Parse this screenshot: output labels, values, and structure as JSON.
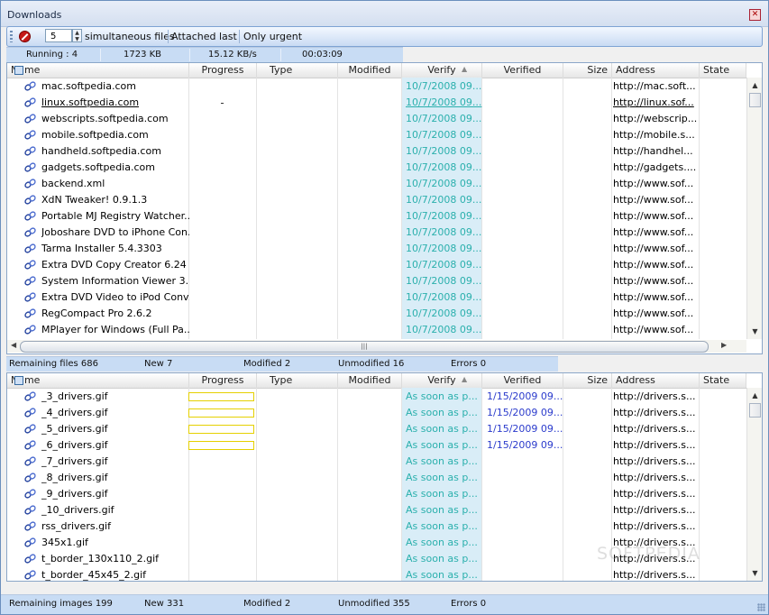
{
  "window": {
    "title": "Downloads",
    "close_icon": "close-icon"
  },
  "toolbar": {
    "simultaneous_value": "5",
    "simultaneous_label": "simultaneous files",
    "attached_last_label": "Attached last",
    "only_urgent_label": "Only urgent"
  },
  "status_top": {
    "running": "Running : 4",
    "size": "1723 KB",
    "speed": "15.12 KB/s",
    "time": "00:03:09"
  },
  "columns": [
    "Name",
    "Progress",
    "Type",
    "Modified",
    "Verify",
    "Verified",
    "Size",
    "Address",
    "State"
  ],
  "top_rows": [
    {
      "name": "mac.softpedia.com",
      "verify": "10/7/2008 09...",
      "address": "http://mac.soft...",
      "underline": false,
      "progress": false
    },
    {
      "name": "linux.softpedia.com",
      "verify": "10/7/2008 09...",
      "address": "http://linux.sof...",
      "underline": true,
      "progress": true
    },
    {
      "name": "webscripts.softpedia.com",
      "verify": "10/7/2008 09...",
      "address": "http://webscrip...",
      "underline": false,
      "progress": false
    },
    {
      "name": "mobile.softpedia.com",
      "verify": "10/7/2008 09...",
      "address": "http://mobile.s...",
      "underline": false,
      "progress": false
    },
    {
      "name": "handheld.softpedia.com",
      "verify": "10/7/2008 09...",
      "address": "http://handhel...",
      "underline": false,
      "progress": false
    },
    {
      "name": "gadgets.softpedia.com",
      "verify": "10/7/2008 09...",
      "address": "http://gadgets....",
      "underline": false,
      "progress": false
    },
    {
      "name": "backend.xml",
      "verify": "10/7/2008 09...",
      "address": "http://www.sof...",
      "underline": false,
      "progress": false
    },
    {
      "name": "XdN Tweaker! 0.9.1.3",
      "verify": "10/7/2008 09...",
      "address": "http://www.sof...",
      "underline": false,
      "progress": false
    },
    {
      "name": "Portable MJ Registry Watcher...",
      "verify": "10/7/2008 09...",
      "address": "http://www.sof...",
      "underline": false,
      "progress": false
    },
    {
      "name": "Joboshare DVD to iPhone Con...",
      "verify": "10/7/2008 09...",
      "address": "http://www.sof...",
      "underline": false,
      "progress": false
    },
    {
      "name": "Tarma Installer 5.4.3303",
      "verify": "10/7/2008 09...",
      "address": "http://www.sof...",
      "underline": false,
      "progress": false
    },
    {
      "name": "Extra DVD Copy Creator 6.24",
      "verify": "10/7/2008 09...",
      "address": "http://www.sof...",
      "underline": false,
      "progress": false
    },
    {
      "name": "System Information Viewer 3....",
      "verify": "10/7/2008 09...",
      "address": "http://www.sof...",
      "underline": false,
      "progress": false
    },
    {
      "name": "Extra DVD Video to iPod Conv...",
      "verify": "10/7/2008 09...",
      "address": "http://www.sof...",
      "underline": false,
      "progress": false
    },
    {
      "name": "RegCompact Pro 2.6.2",
      "verify": "10/7/2008 09...",
      "address": "http://www.sof...",
      "underline": false,
      "progress": false
    },
    {
      "name": "MPlayer for Windows (Full Pa...",
      "verify": "10/7/2008 09...",
      "address": "http://www.sof...",
      "underline": false,
      "progress": false
    }
  ],
  "status_mid": {
    "remaining": "Remaining files 686",
    "new": "New 7",
    "modified": "Modified 2",
    "unmodified": "Unmodified 16",
    "errors": "Errors 0"
  },
  "bottom_rows": [
    {
      "name": "_3_drivers.gif",
      "verify": "As soon as p...",
      "verified": "1/15/2009 09...",
      "address": "http://drivers.s...",
      "progress": true
    },
    {
      "name": "_4_drivers.gif",
      "verify": "As soon as p...",
      "verified": "1/15/2009 09...",
      "address": "http://drivers.s...",
      "progress": true
    },
    {
      "name": "_5_drivers.gif",
      "verify": "As soon as p...",
      "verified": "1/15/2009 09...",
      "address": "http://drivers.s...",
      "progress": true
    },
    {
      "name": "_6_drivers.gif",
      "verify": "As soon as p...",
      "verified": "1/15/2009 09...",
      "address": "http://drivers.s...",
      "progress": true
    },
    {
      "name": "_7_drivers.gif",
      "verify": "As soon as p...",
      "verified": "",
      "address": "http://drivers.s...",
      "progress": false
    },
    {
      "name": "_8_drivers.gif",
      "verify": "As soon as p...",
      "verified": "",
      "address": "http://drivers.s...",
      "progress": false
    },
    {
      "name": "_9_drivers.gif",
      "verify": "As soon as p...",
      "verified": "",
      "address": "http://drivers.s...",
      "progress": false
    },
    {
      "name": "_10_drivers.gif",
      "verify": "As soon as p...",
      "verified": "",
      "address": "http://drivers.s...",
      "progress": false
    },
    {
      "name": "rss_drivers.gif",
      "verify": "As soon as p...",
      "verified": "",
      "address": "http://drivers.s...",
      "progress": false
    },
    {
      "name": "345x1.gif",
      "verify": "As soon as p...",
      "verified": "",
      "address": "http://drivers.s...",
      "progress": false
    },
    {
      "name": "t_border_130x110_2.gif",
      "verify": "As soon as p...",
      "verified": "",
      "address": "http://drivers.s...",
      "progress": false
    },
    {
      "name": "t_border_45x45_2.gif",
      "verify": "As soon as p...",
      "verified": "",
      "address": "http://drivers.s...",
      "progress": false
    }
  ],
  "status_bottom": {
    "remaining": "Remaining images 199",
    "new": "New 331",
    "modified": "Modified 2",
    "unmodified": "Unmodified 355",
    "errors": "Errors 0"
  },
  "watermark": "SOFTPEDIA",
  "colors": {
    "verify_text": "#2bb0ad",
    "verified_text": "#2b3bcc",
    "verify_bg": "#d9edf7",
    "statusbar": "#c8dcf4"
  }
}
